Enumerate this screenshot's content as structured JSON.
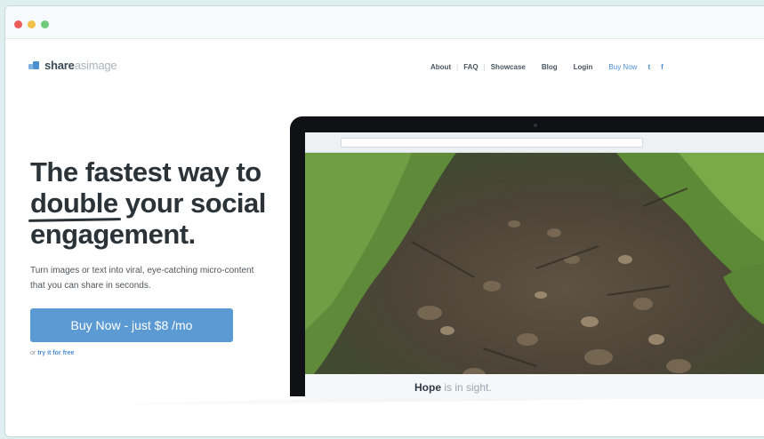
{
  "brand": {
    "name_bold": "share",
    "name_light": "asimage"
  },
  "nav": {
    "items": [
      "About",
      "FAQ",
      "Showcase",
      "Blog",
      "Login"
    ],
    "buy": "Buy Now",
    "twitter": "t",
    "facebook": "f"
  },
  "hero": {
    "line1": "The fastest way to",
    "line2_emph": "double",
    "line2_rest": " your social",
    "line3": "engagement.",
    "subtitle": "Turn images or text into viral, eye-catching micro-content that you can share in seconds.",
    "cta": "Buy Now - just $8 /mo",
    "try_prefix": "or",
    "try_link": "try it for free"
  },
  "preview": {
    "caption_bold": "Hope",
    "caption_light": " is in sight."
  }
}
